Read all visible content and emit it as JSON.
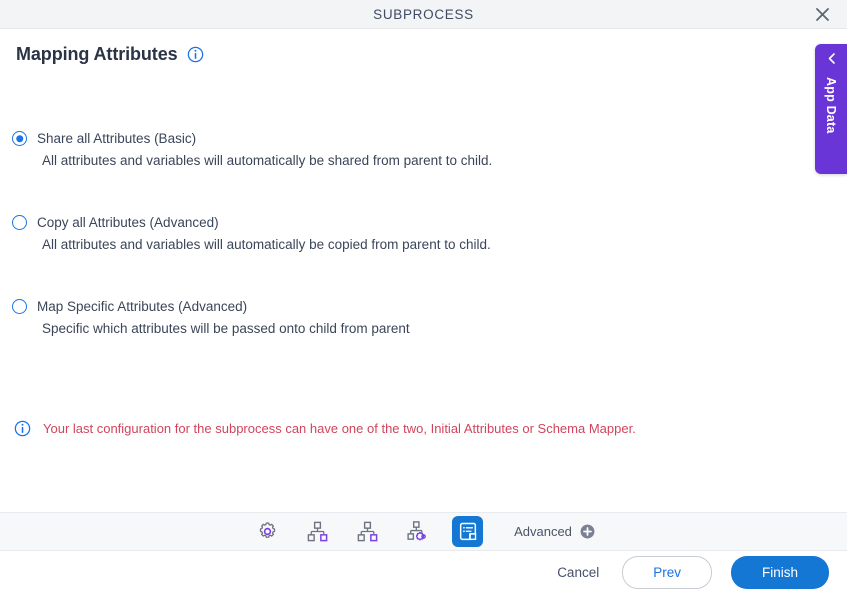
{
  "window": {
    "title": "SUBPROCESS",
    "close_icon": "close-icon"
  },
  "header": {
    "title": "Mapping Attributes",
    "info_icon": "info-circle-icon"
  },
  "side_panel": {
    "label": "App Data",
    "chevron_icon": "chevron-left-icon"
  },
  "options": [
    {
      "label": "Share all Attributes (Basic)",
      "description": "All attributes and variables will automatically be shared from parent to child.",
      "selected": true
    },
    {
      "label": "Copy all Attributes (Advanced)",
      "description": "All attributes and variables will automatically be copied from parent to child.",
      "selected": false
    },
    {
      "label": "Map Specific Attributes (Advanced)",
      "description": "Specific which attributes will be passed onto child from parent",
      "selected": false
    }
  ],
  "notice": {
    "icon": "info-circle-icon",
    "text": "Your last configuration for the subprocess can have one of the two, Initial Attributes or Schema Mapper.",
    "color": "#d0455c"
  },
  "toolbar": {
    "items": [
      {
        "icon": "gear-icon",
        "active": false
      },
      {
        "icon": "hierarchy-icon",
        "active": false
      },
      {
        "icon": "hierarchy-alt-icon",
        "active": false
      },
      {
        "icon": "hierarchy-settings-icon",
        "active": false
      },
      {
        "icon": "form-list-icon",
        "active": true
      }
    ],
    "advanced_label": "Advanced",
    "advanced_plus_icon": "plus-circle-icon",
    "active_color": "#1477d4",
    "accent_purple": "#7b3fe4"
  },
  "footer": {
    "cancel_label": "Cancel",
    "prev_label": "Prev",
    "finish_label": "Finish",
    "primary_color": "#1477d4"
  }
}
